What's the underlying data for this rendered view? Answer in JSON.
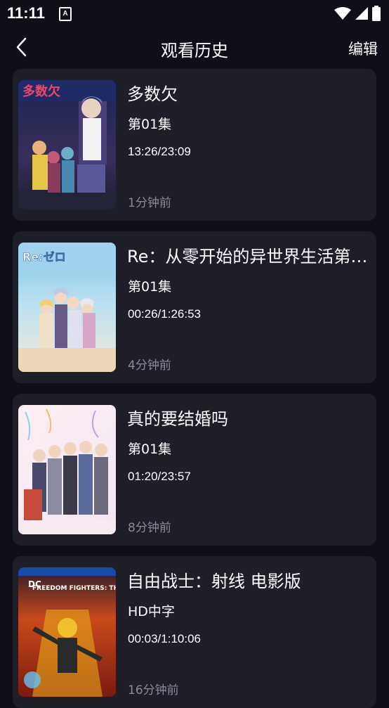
{
  "status_bar": {
    "time": "11:11",
    "notification_letter": "A"
  },
  "header": {
    "title": "观看历史",
    "edit_label": "编辑"
  },
  "items": [
    {
      "title": "多数欠",
      "episode": "第01集",
      "progress": "13:26/23:09",
      "ago": "1分钟前",
      "poster_text": "多数欠"
    },
    {
      "title": "Re：从零开始的异世界生活第三季",
      "episode": "第01集",
      "progress": "00:26/1:26:53",
      "ago": "4分钟前",
      "poster_text": "Re:ゼロ"
    },
    {
      "title": "真的要结婚吗",
      "episode": "第01集",
      "progress": "01:20/23:57",
      "ago": "8分钟前",
      "poster_text": ""
    },
    {
      "title": "自由战士：射线 电影版",
      "episode": "HD中字",
      "progress": "00:03/1:10:06",
      "ago": "16分钟前",
      "poster_text": "FREEDOM FIGHTERS: THE RAY"
    }
  ]
}
